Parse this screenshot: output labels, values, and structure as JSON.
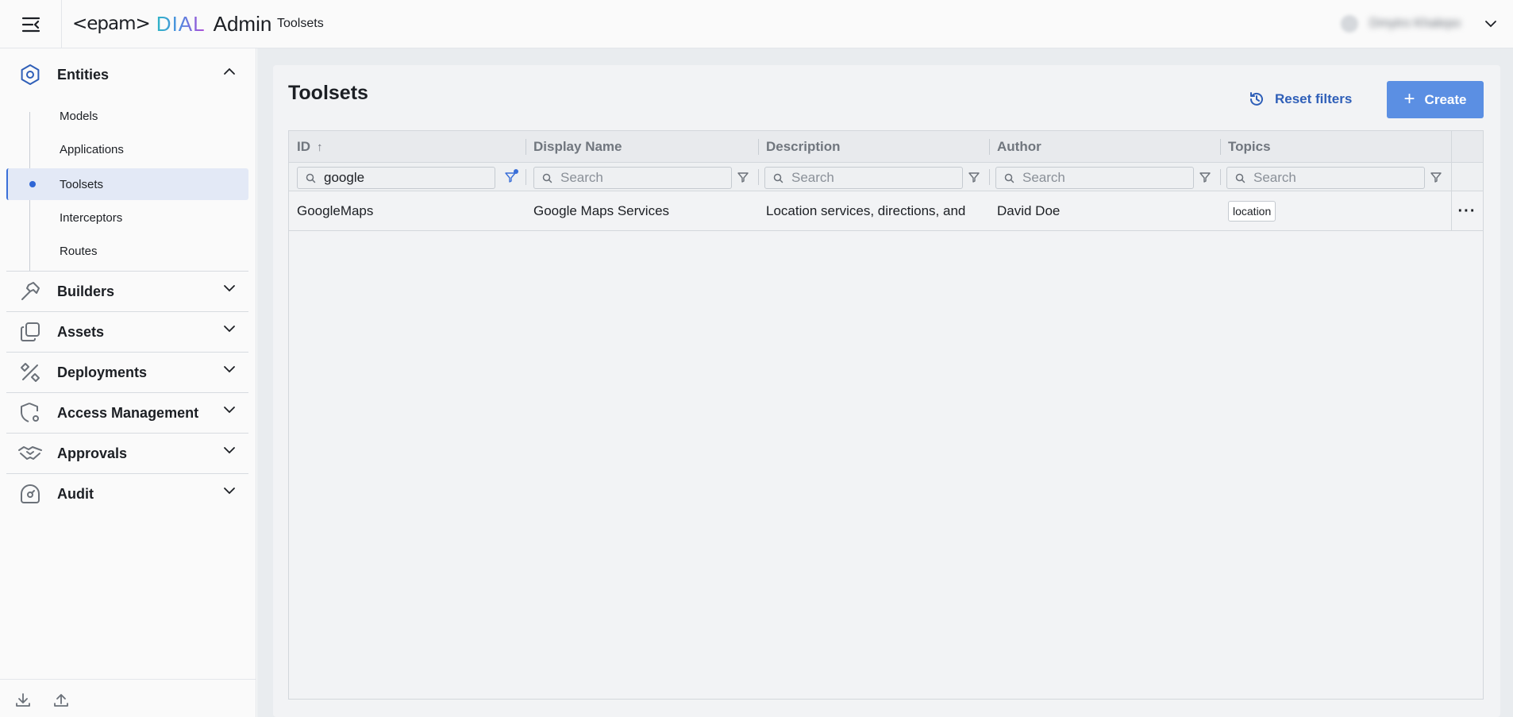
{
  "header": {
    "logo_epam": "<epam>",
    "logo_dial": "DIAL",
    "logo_admin": "Admin",
    "breadcrumb": "Toolsets",
    "user_name": "Dmytro Khalepo"
  },
  "sidebar": {
    "sections": [
      {
        "label": "Entities",
        "icon": "hexagon-icon",
        "expanded": true
      },
      {
        "label": "Builders",
        "icon": "hammer-icon",
        "expanded": false
      },
      {
        "label": "Assets",
        "icon": "copy-icon",
        "expanded": false
      },
      {
        "label": "Deployments",
        "icon": "tools-icon",
        "expanded": false
      },
      {
        "label": "Access Management",
        "icon": "shield-gear-icon",
        "expanded": false
      },
      {
        "label": "Approvals",
        "icon": "handshake-icon",
        "expanded": false
      },
      {
        "label": "Audit",
        "icon": "gauge-icon",
        "expanded": false
      }
    ],
    "entities_items": [
      {
        "label": "Models"
      },
      {
        "label": "Applications"
      },
      {
        "label": "Toolsets",
        "active": true
      },
      {
        "label": "Interceptors"
      },
      {
        "label": "Routes"
      }
    ]
  },
  "page": {
    "title": "Toolsets",
    "reset_label": "Reset filters",
    "create_label": "Create"
  },
  "grid": {
    "columns": [
      "ID",
      "Display Name",
      "Description",
      "Author",
      "Topics"
    ],
    "sort_indicator": "↑",
    "filters": {
      "id_value": "google",
      "placeholder": "Search"
    },
    "rows": [
      {
        "id": "GoogleMaps",
        "display_name": "Google Maps Services",
        "description": "Location services, directions, and",
        "author": "David Doe",
        "topics": [
          "location"
        ]
      }
    ],
    "more_label": "···"
  },
  "colors": {
    "accent": "#2f66d5",
    "create_button": "#5b8fe3",
    "active_item_bg": "#e3e9f6"
  }
}
